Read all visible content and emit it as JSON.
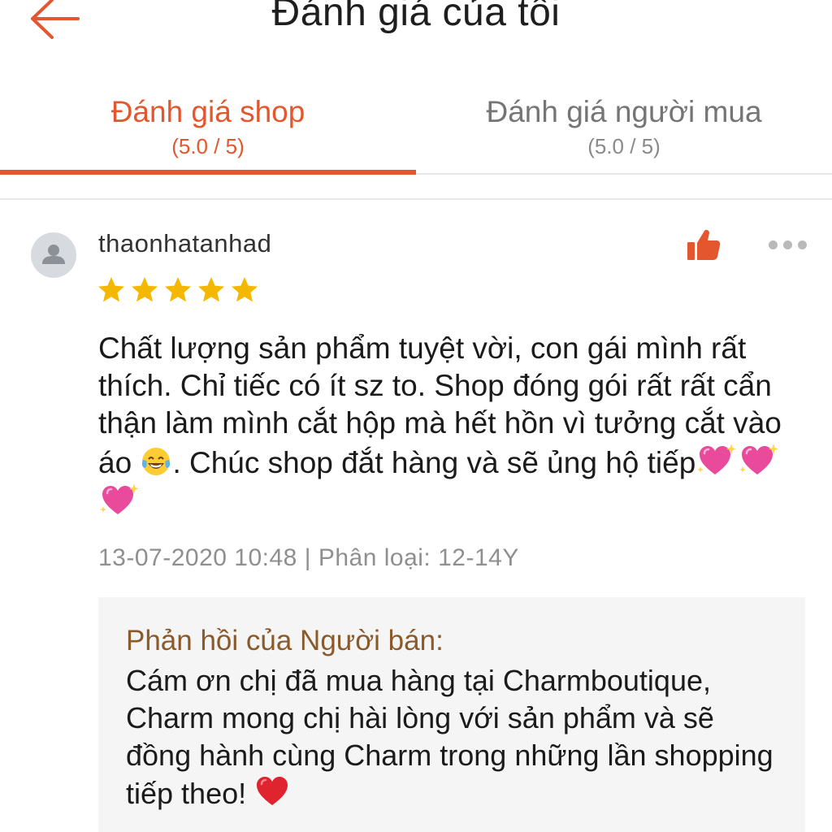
{
  "header": {
    "title": "Đánh giá của tôi",
    "back_icon": "arrow-left-icon",
    "accent_color": "#e4572e"
  },
  "tabs": [
    {
      "label": "Đánh giá shop",
      "score": "(5.0 / 5)",
      "active": true
    },
    {
      "label": "Đánh giá người mua",
      "score": "(5.0 / 5)",
      "active": false
    }
  ],
  "review": {
    "username": "thaonhatanhad",
    "rating": 5,
    "rating_max": 5,
    "star_color": "#f5b800",
    "like_icon": "thumbs-up-icon",
    "more_icon": "more-dots-icon",
    "text_part1": "Chất lượng sản phẩm tuyệt vời, con gái mình rất thích. Chỉ tiếc có ít sz to. Shop đóng gói rất rất cẩn thận làm mình cắt hộp mà hết hồn vì tưởng cắt vào áo ",
    "text_part2": ". Chúc shop đắt hàng và sẽ ủng hộ tiếp",
    "emoji_laugh": "laughing-tears-emoji",
    "emoji_hearts": [
      "sparkling-heart-emoji",
      "sparkling-heart-emoji",
      "sparkling-heart-emoji"
    ],
    "meta": "13-07-2020 10:48 | Phân loại: 12-14Y"
  },
  "seller_reply": {
    "title": "Phản hồi của Người bán:",
    "text": "Cám ơn chị đã mua hàng tại Charmboutique, Charm mong chị hài lòng với sản phẩm và sẽ đồng hành cùng Charm trong những lần shopping tiếp theo! ",
    "emoji": "red-heart-emoji"
  }
}
